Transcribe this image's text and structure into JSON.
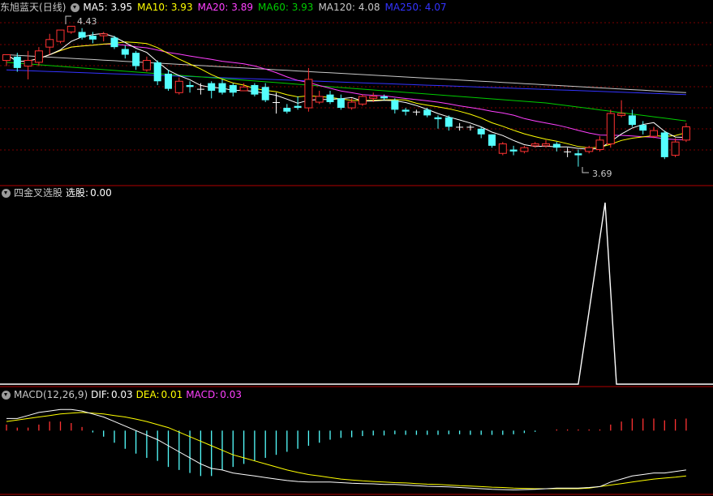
{
  "main": {
    "stock_name": "东旭蓝天",
    "period": "(日线)",
    "ma": [
      {
        "label": "MA5:",
        "value": "3.95",
        "color": "#ffffff"
      },
      {
        "label": "MA10:",
        "value": "3.93",
        "color": "#ffff00"
      },
      {
        "label": "MA20:",
        "value": "3.89",
        "color": "#ff40ff"
      },
      {
        "label": "MA60:",
        "value": "3.93",
        "color": "#00cc00"
      },
      {
        "label": "MA120:",
        "value": "4.08",
        "color": "#c8c8c8"
      },
      {
        "label": "MA250:",
        "value": "4.07",
        "color": "#3333ff"
      }
    ],
    "high_label": "4.43",
    "low_label": "3.69"
  },
  "indicator": {
    "name": "四金叉选股",
    "field_label": "选股:",
    "field_value": "0.00"
  },
  "macd": {
    "name": "MACD(12,26,9)",
    "dif_label": "DIF:",
    "dif_value": "0.03",
    "dea_label": "DEA:",
    "dea_value": "0.01",
    "macd_label": "MACD:",
    "macd_value": "0.03"
  },
  "chart_data": [
    {
      "type": "candlestick",
      "price_range": [
        3.62,
        4.5
      ],
      "candles": [
        [
          4.25,
          4.28,
          4.27,
          4.22
        ],
        [
          4.27,
          4.21,
          4.29,
          4.19
        ],
        [
          4.22,
          4.25,
          4.3,
          4.15
        ],
        [
          4.24,
          4.3,
          4.32,
          4.22
        ],
        [
          4.32,
          4.36,
          4.39,
          4.28
        ],
        [
          4.35,
          4.41,
          4.41,
          4.34
        ],
        [
          4.4,
          4.43,
          4.43,
          4.39
        ],
        [
          4.4,
          4.37,
          4.42,
          4.36
        ],
        [
          4.38,
          4.36,
          4.4,
          4.34
        ],
        [
          4.38,
          4.39,
          4.4,
          4.35
        ],
        [
          4.37,
          4.32,
          4.38,
          4.31
        ],
        [
          4.31,
          4.28,
          4.33,
          4.26
        ],
        [
          4.29,
          4.22,
          4.3,
          4.2
        ],
        [
          4.2,
          4.25,
          4.27,
          4.19
        ],
        [
          4.24,
          4.14,
          4.25,
          4.12
        ],
        [
          4.18,
          4.1,
          4.2,
          4.09
        ],
        [
          4.08,
          4.14,
          4.16,
          4.07
        ],
        [
          4.12,
          4.11,
          4.14,
          4.08
        ],
        [
          4.1,
          4.1,
          4.13,
          4.07
        ],
        [
          4.13,
          4.09,
          4.14,
          4.05
        ],
        [
          4.13,
          4.08,
          4.15,
          4.07
        ],
        [
          4.12,
          4.08,
          4.13,
          4.06
        ],
        [
          4.09,
          4.11,
          4.13,
          4.09
        ],
        [
          4.12,
          4.07,
          4.13,
          4.06
        ],
        [
          4.11,
          4.04,
          4.13,
          4.03
        ],
        [
          4.03,
          4.03,
          4.08,
          3.97
        ],
        [
          4.0,
          3.98,
          4.02,
          3.97
        ],
        [
          4.01,
          4.0,
          4.06,
          3.99
        ],
        [
          4.0,
          4.15,
          4.21,
          3.98
        ],
        [
          4.03,
          4.06,
          4.09,
          4.02
        ],
        [
          4.07,
          4.03,
          4.09,
          4.02
        ],
        [
          4.05,
          4.0,
          4.07,
          3.99
        ],
        [
          4.0,
          4.03,
          4.05,
          3.99
        ],
        [
          4.02,
          4.06,
          4.07,
          4.01
        ],
        [
          4.05,
          4.06,
          4.08,
          4.03
        ],
        [
          4.06,
          4.05,
          4.07,
          4.04
        ],
        [
          4.04,
          3.99,
          4.05,
          3.97
        ],
        [
          3.99,
          3.98,
          4.0,
          3.96
        ],
        [
          3.98,
          3.98,
          3.99,
          3.96
        ],
        [
          3.99,
          3.96,
          4.0,
          3.95
        ],
        [
          3.95,
          3.94,
          3.96,
          3.89
        ],
        [
          3.95,
          3.9,
          3.96,
          3.88
        ],
        [
          3.9,
          3.9,
          3.92,
          3.88
        ],
        [
          3.9,
          3.9,
          3.91,
          3.88
        ],
        [
          3.89,
          3.86,
          3.9,
          3.84
        ],
        [
          3.86,
          3.8,
          3.86,
          3.79
        ],
        [
          3.76,
          3.81,
          3.82,
          3.75
        ],
        [
          3.78,
          3.77,
          3.8,
          3.75
        ],
        [
          3.77,
          3.79,
          3.8,
          3.76
        ],
        [
          3.8,
          3.81,
          3.82,
          3.79
        ],
        [
          3.8,
          3.81,
          3.83,
          3.79
        ],
        [
          3.81,
          3.79,
          3.82,
          3.77
        ],
        [
          3.77,
          3.77,
          3.79,
          3.74
        ],
        [
          3.76,
          3.75,
          3.78,
          3.69
        ],
        [
          3.77,
          3.79,
          3.8,
          3.76
        ],
        [
          3.78,
          3.83,
          3.85,
          3.77
        ],
        [
          3.81,
          3.97,
          3.99,
          3.79
        ],
        [
          3.96,
          3.97,
          4.04,
          3.95
        ],
        [
          3.96,
          3.91,
          3.99,
          3.9
        ],
        [
          3.91,
          3.88,
          3.93,
          3.86
        ],
        [
          3.85,
          3.88,
          3.9,
          3.84
        ],
        [
          3.87,
          3.74,
          3.88,
          3.73
        ],
        [
          3.75,
          3.82,
          3.84,
          3.74
        ],
        [
          3.83,
          3.9,
          3.92,
          3.82
        ]
      ]
    },
    {
      "type": "line",
      "name": "选股",
      "values": [
        0,
        0,
        0,
        0,
        0,
        0,
        0,
        0,
        0,
        0,
        0,
        0,
        0,
        0,
        0,
        0,
        0,
        0,
        0,
        0,
        0,
        0,
        0,
        0,
        0,
        0,
        0,
        0,
        0,
        0,
        0,
        0,
        0,
        0,
        0,
        0,
        0,
        0,
        0,
        0,
        0,
        0,
        0,
        0,
        0,
        0,
        0,
        0,
        0,
        0,
        0,
        0,
        0,
        0,
        1,
        0,
        0,
        0,
        0,
        0,
        0,
        0,
        0,
        0
      ],
      "ylim": [
        0,
        1
      ]
    },
    {
      "type": "line+bar",
      "name": "MACD(12,26,9)",
      "ylim": [
        -0.2,
        0.1
      ],
      "dif": [
        0.04,
        0.04,
        0.05,
        0.06,
        0.065,
        0.07,
        0.07,
        0.065,
        0.055,
        0.045,
        0.03,
        0.015,
        0.0,
        -0.015,
        -0.03,
        -0.05,
        -0.07,
        -0.09,
        -0.11,
        -0.125,
        -0.13,
        -0.14,
        -0.145,
        -0.15,
        -0.155,
        -0.16,
        -0.165,
        -0.168,
        -0.17,
        -0.17,
        -0.17,
        -0.172,
        -0.174,
        -0.175,
        -0.176,
        -0.178,
        -0.178,
        -0.18,
        -0.182,
        -0.184,
        -0.185,
        -0.186,
        -0.188,
        -0.19,
        -0.192,
        -0.194,
        -0.195,
        -0.196,
        -0.195,
        -0.194,
        -0.192,
        -0.19,
        -0.19,
        -0.19,
        -0.188,
        -0.185,
        -0.17,
        -0.16,
        -0.15,
        -0.145,
        -0.14,
        -0.14,
        -0.135,
        -0.13
      ],
      "dea": [
        0.03,
        0.035,
        0.04,
        0.045,
        0.05,
        0.055,
        0.058,
        0.06,
        0.058,
        0.055,
        0.05,
        0.045,
        0.038,
        0.03,
        0.02,
        0.01,
        -0.005,
        -0.02,
        -0.035,
        -0.05,
        -0.065,
        -0.08,
        -0.09,
        -0.1,
        -0.11,
        -0.12,
        -0.13,
        -0.138,
        -0.145,
        -0.15,
        -0.155,
        -0.16,
        -0.163,
        -0.166,
        -0.168,
        -0.17,
        -0.172,
        -0.173,
        -0.175,
        -0.177,
        -0.178,
        -0.18,
        -0.182,
        -0.183,
        -0.185,
        -0.187,
        -0.188,
        -0.19,
        -0.191,
        -0.192,
        -0.192,
        -0.192,
        -0.192,
        -0.192,
        -0.19,
        -0.185,
        -0.18,
        -0.175,
        -0.17,
        -0.165,
        -0.16,
        -0.157,
        -0.154,
        -0.15
      ],
      "macd": [
        0.02,
        0.01,
        0.01,
        0.02,
        0.03,
        0.03,
        0.025,
        0.012,
        -0.006,
        -0.02,
        -0.04,
        -0.06,
        -0.076,
        -0.09,
        -0.1,
        -0.12,
        -0.13,
        -0.14,
        -0.15,
        -0.15,
        -0.13,
        -0.12,
        -0.11,
        -0.1,
        -0.09,
        -0.08,
        -0.07,
        -0.06,
        -0.05,
        -0.04,
        -0.03,
        -0.024,
        -0.022,
        -0.018,
        -0.016,
        -0.016,
        -0.012,
        -0.014,
        -0.014,
        -0.014,
        -0.014,
        -0.012,
        -0.012,
        -0.014,
        -0.014,
        -0.014,
        -0.014,
        -0.012,
        -0.008,
        -0.004,
        0.0,
        0.004,
        0.004,
        0.004,
        0.004,
        0.004,
        0.02,
        0.03,
        0.04,
        0.04,
        0.04,
        0.034,
        0.038,
        0.04
      ]
    }
  ],
  "colors": {
    "up": "#ff3232",
    "down": "#54ffff",
    "flat": "#ffffff",
    "ma5": "#ffffff",
    "ma10": "#ffff00",
    "ma20": "#ff40ff",
    "ma60": "#00cc00",
    "ma120": "#c8c8c8",
    "ma250": "#3333ff",
    "grid": "#7a0000",
    "divider": "#b00000",
    "dif": "#ffffff",
    "dea": "#ffff00",
    "signal": "#ffffff"
  }
}
